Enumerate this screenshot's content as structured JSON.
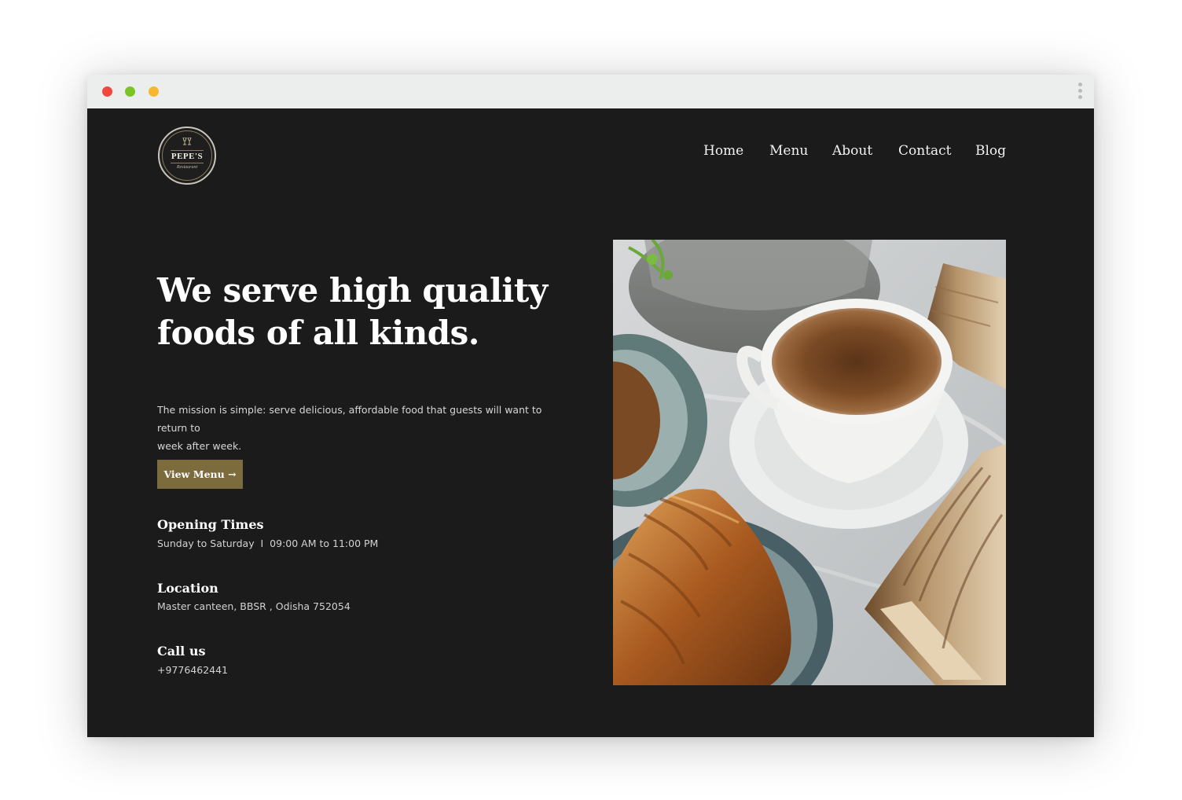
{
  "window": {
    "controls": [
      "close",
      "maximize",
      "minimize"
    ]
  },
  "brand": {
    "name": "PEPE'S",
    "tagline": "Restaurant",
    "icon": "wine-glass-icon"
  },
  "nav": {
    "items": [
      {
        "label": "Home"
      },
      {
        "label": "Menu"
      },
      {
        "label": "About"
      },
      {
        "label": "Contact"
      },
      {
        "label": "Blog"
      }
    ]
  },
  "hero": {
    "headline_line1": "We serve high quality",
    "headline_line2": "foods of all kinds.",
    "mission_line1": "The mission is simple: serve delicious, affordable food that guests will want to return to",
    "mission_line2": "week after week.",
    "cta_label": "View Menu →",
    "image_subject": "coffee-and-croissant-photo"
  },
  "info": {
    "opening": {
      "title": "Opening Times",
      "text": "Sunday to Saturday  I  09:00 AM to 11:00 PM"
    },
    "location": {
      "title": "Location",
      "text": "Master canteen, BBSR , Odisha 752054"
    },
    "call": {
      "title": "Call us",
      "text": "+9776462441"
    }
  },
  "colors": {
    "background": "#1b1b1c",
    "accent": "#7b6b3d",
    "text": "#ffffff",
    "titlebar": "#eceeee"
  }
}
